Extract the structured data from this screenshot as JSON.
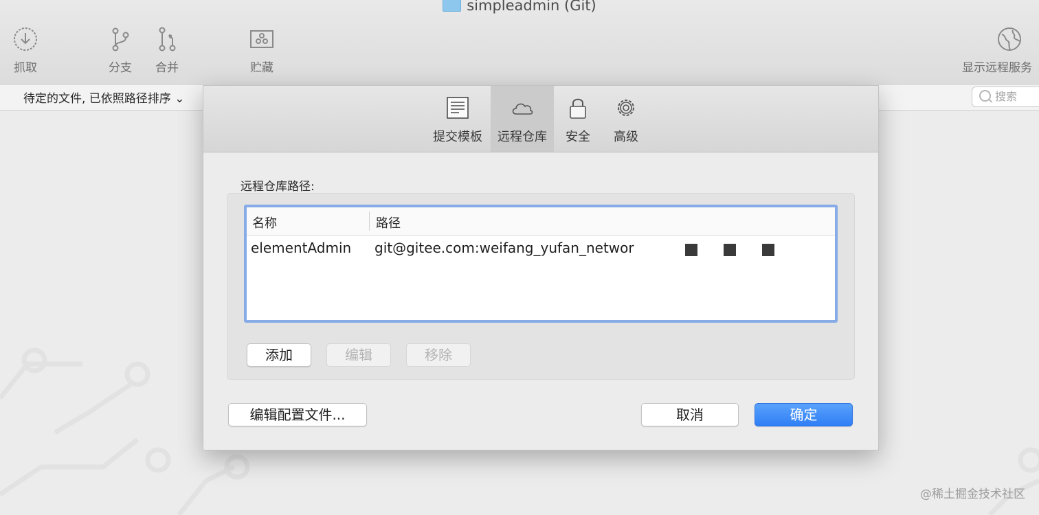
{
  "window": {
    "title": "simpleadmin (Git)"
  },
  "toolbar": {
    "fetch": "抓取",
    "branch": "分支",
    "merge": "合并",
    "stash": "贮藏",
    "show_remote": "显示远程服务"
  },
  "subbar": {
    "sort_label": "待定的文件, 已依照路径排序",
    "search_placeholder": "搜索"
  },
  "dialog": {
    "tabs": [
      {
        "label": "提交模板",
        "icon": "document-icon",
        "active": false
      },
      {
        "label": "远程仓库",
        "icon": "cloud-icon",
        "active": true
      },
      {
        "label": "安全",
        "icon": "lock-icon",
        "active": false
      },
      {
        "label": "高级",
        "icon": "gear-icon",
        "active": false
      }
    ],
    "section_label": "远程仓库路径:",
    "table": {
      "columns": [
        "名称",
        "路径"
      ],
      "rows": [
        {
          "name": "elementAdmin",
          "path": "git@gitee.com:weifang_yufan_networ"
        }
      ]
    },
    "buttons": {
      "add": "添加",
      "edit": "编辑",
      "remove": "移除",
      "edit_config": "编辑配置文件...",
      "cancel": "取消",
      "ok": "确定"
    }
  },
  "watermark": "@稀土掘金技术社区",
  "colors": {
    "accent": "#2f7ef6",
    "table_focus": "#86abe6"
  }
}
